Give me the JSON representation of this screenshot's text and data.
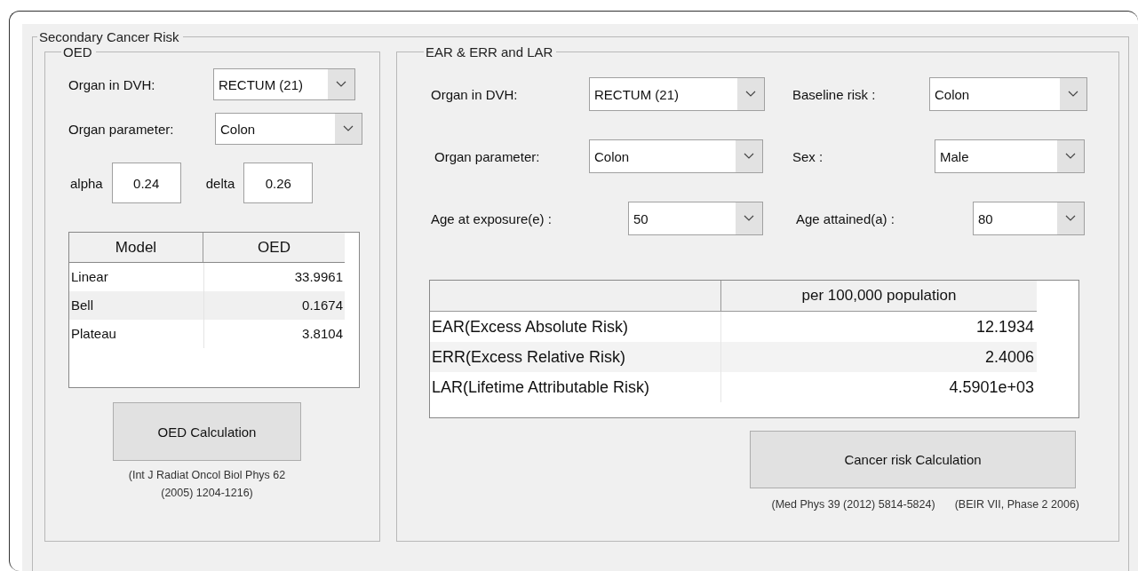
{
  "group": {
    "title": "Secondary Cancer Risk"
  },
  "oed": {
    "title": "OED",
    "fields": [
      {
        "label": "Organ in DVH:",
        "value": "RECTUM (21)"
      },
      {
        "label": "Organ parameter:",
        "value": "Colon"
      }
    ],
    "params": [
      {
        "label": "alpha",
        "value": "0.24"
      },
      {
        "label": "delta",
        "value": "0.26"
      }
    ],
    "table": {
      "columns": [
        "Model",
        "OED"
      ],
      "rows": [
        [
          "Linear",
          "33.9961"
        ],
        [
          "Bell",
          "0.1674"
        ],
        [
          "Plateau",
          "3.8104"
        ]
      ]
    },
    "button": "OED Calculation",
    "reference": "(Int J Radiat Oncol Biol Phys 62 (2005) 1204-1216)"
  },
  "risk": {
    "title": "EAR & ERR and LAR",
    "fields": [
      {
        "label": "Organ in DVH:",
        "value": "RECTUM (21)"
      },
      {
        "label": "Baseline risk :",
        "value": "Colon"
      },
      {
        "label": "Organ parameter:",
        "value": "Colon"
      },
      {
        "label": "Sex :",
        "value": "Male"
      },
      {
        "label": "Age at exposure(e) :",
        "value": "50"
      },
      {
        "label": "Age attained(a) :",
        "value": "80"
      }
    ],
    "table": {
      "column_2": "per 100,000 population",
      "rows": [
        [
          "EAR(Excess Absolute Risk)",
          "12.1934"
        ],
        [
          "ERR(Excess Relative Risk)",
          "2.4006"
        ],
        [
          "LAR(Lifetime Attributable Risk)",
          "4.5901e+03"
        ]
      ]
    },
    "button": "Cancer risk Calculation",
    "references": [
      "(Med Phys 39 (2012) 5814-5824)",
      "(BEIR VII, Phase 2 2006)"
    ]
  }
}
